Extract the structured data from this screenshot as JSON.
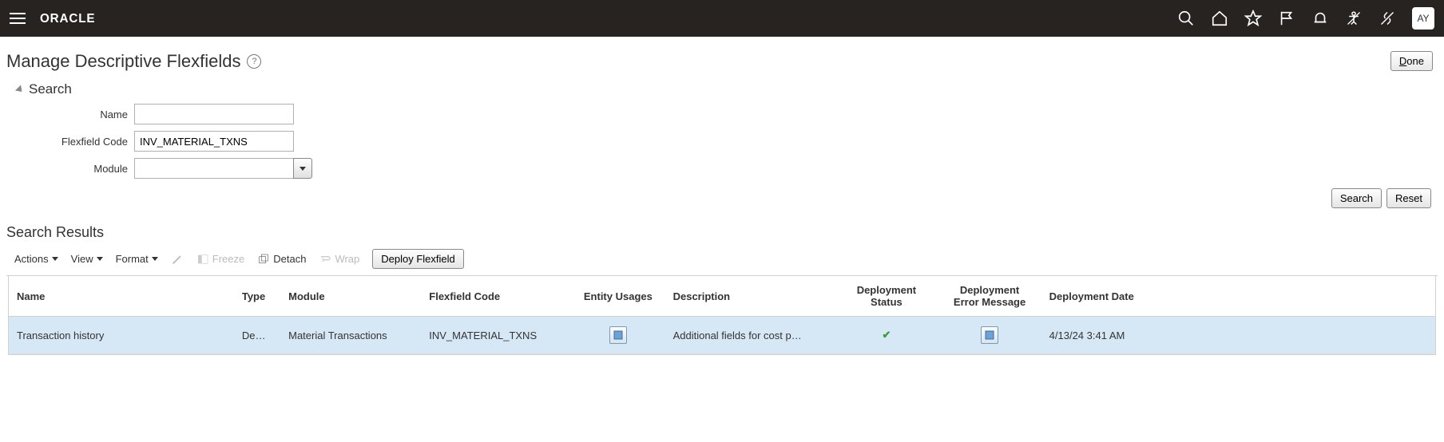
{
  "header": {
    "logo_text": "ORACLE",
    "avatar": "AY"
  },
  "page": {
    "title": "Manage Descriptive Flexfields",
    "done_prefix": "D",
    "done_suffix": "one"
  },
  "search": {
    "section_label": "Search",
    "labels": {
      "name": "Name",
      "flexfield_code": "Flexfield Code",
      "module": "Module"
    },
    "values": {
      "name": "",
      "flexfield_code": "INV_MATERIAL_TXNS",
      "module": ""
    },
    "buttons": {
      "search": "Search",
      "reset": "Reset"
    }
  },
  "results": {
    "title": "Search Results",
    "toolbar": {
      "actions": "Actions",
      "view": "View",
      "format": "Format",
      "freeze": "Freeze",
      "detach": "Detach",
      "wrap": "Wrap",
      "deploy": "Deploy Flexfield"
    },
    "columns": {
      "name": "Name",
      "type": "Type",
      "module": "Module",
      "flexfield_code": "Flexfield Code",
      "entity_usages": "Entity Usages",
      "description": "Description",
      "deployment_status": "Deployment Status",
      "deployment_error": "Deployment Error Message",
      "deployment_date": "Deployment Date"
    },
    "rows": [
      {
        "name": "Transaction history",
        "type": "De…",
        "module": "Material Transactions",
        "flexfield_code": "INV_MATERIAL_TXNS",
        "description": "Additional fields for cost p…",
        "deployment_status": "✔",
        "deployment_date": "4/13/24 3:41 AM"
      }
    ]
  }
}
